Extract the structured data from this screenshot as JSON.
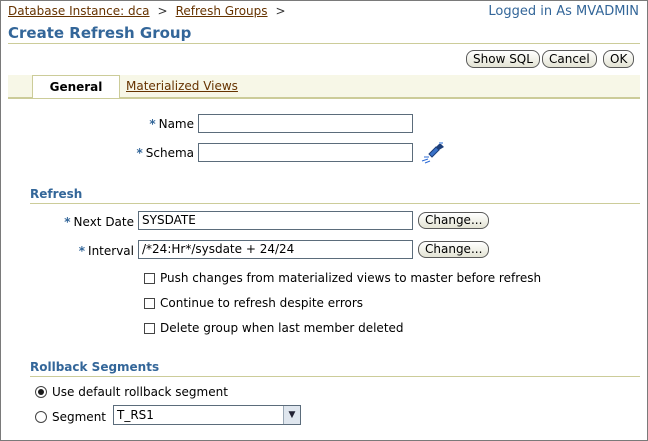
{
  "breadcrumb": {
    "items": [
      "Database Instance: dca",
      "Refresh Groups"
    ],
    "separator": ">"
  },
  "login_text": "Logged in As MVADMIN",
  "page_title": "Create Refresh Group",
  "toolbar": {
    "show_sql": "Show SQL",
    "cancel": "Cancel",
    "ok": "OK"
  },
  "tabs": [
    {
      "label": "General",
      "active": true
    },
    {
      "label": "Materialized Views",
      "active": false
    }
  ],
  "general": {
    "required_marker": "*",
    "name_label": "Name",
    "name_value": "",
    "schema_label": "Schema",
    "schema_value": "",
    "flashlight_icon": "flashlight-icon"
  },
  "refresh": {
    "heading": "Refresh",
    "next_date_label": "Next Date",
    "next_date_value": "SYSDATE",
    "interval_label": "Interval",
    "interval_value": "/*24:Hr*/sysdate + 24/24",
    "change_label": "Change...",
    "options": [
      {
        "label": "Push changes from materialized views to master before refresh",
        "checked": false
      },
      {
        "label": "Continue to refresh despite errors",
        "checked": false
      },
      {
        "label": "Delete group when last member deleted",
        "checked": false
      }
    ]
  },
  "rollback": {
    "heading": "Rollback Segments",
    "default_label": "Use default rollback segment",
    "segment_label": "Segment",
    "segment_value": "T_RS1",
    "selected": "default"
  },
  "colors": {
    "accent": "#336699",
    "link": "#663300",
    "rule": "#cccc99"
  }
}
